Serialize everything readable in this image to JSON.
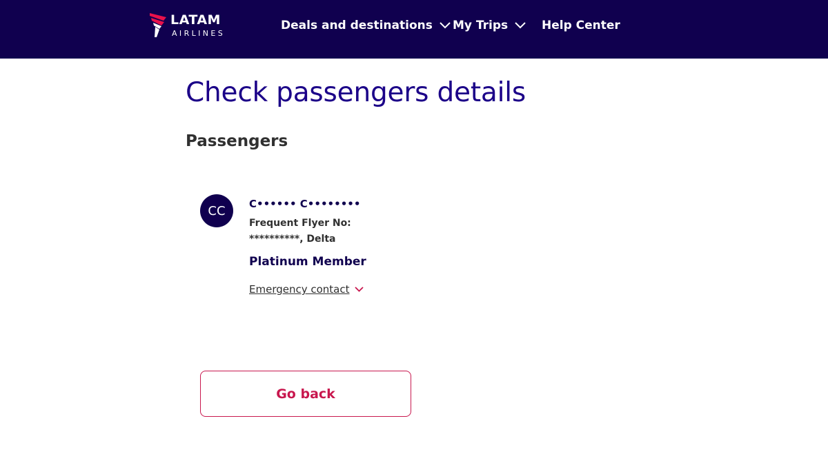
{
  "header": {
    "logo": {
      "brand": "LATAM",
      "sub": "AIRLINES"
    },
    "nav": [
      {
        "label": "Deals and destinations",
        "has_dropdown": true,
        "icon": "chevron-down-icon"
      },
      {
        "label": "My Trips",
        "has_dropdown": true,
        "icon": "chevron-down-icon"
      },
      {
        "label": "Help Center",
        "has_dropdown": false
      }
    ]
  },
  "main": {
    "title": "Check passengers details",
    "section_title": "Passengers",
    "passenger": {
      "initials": "CC",
      "name": "C•••••• C••••••••",
      "frequent_flyer_label": "Frequent Flyer No:",
      "frequent_flyer_value": "**********, Delta",
      "tier": "Platinum Member",
      "emergency_contact": "Emergency contact"
    },
    "go_back_label": "Go back"
  },
  "colors": {
    "header_bg": "#10004f",
    "title": "#1b0088",
    "accent": "#c8174e",
    "text": "#303030"
  }
}
